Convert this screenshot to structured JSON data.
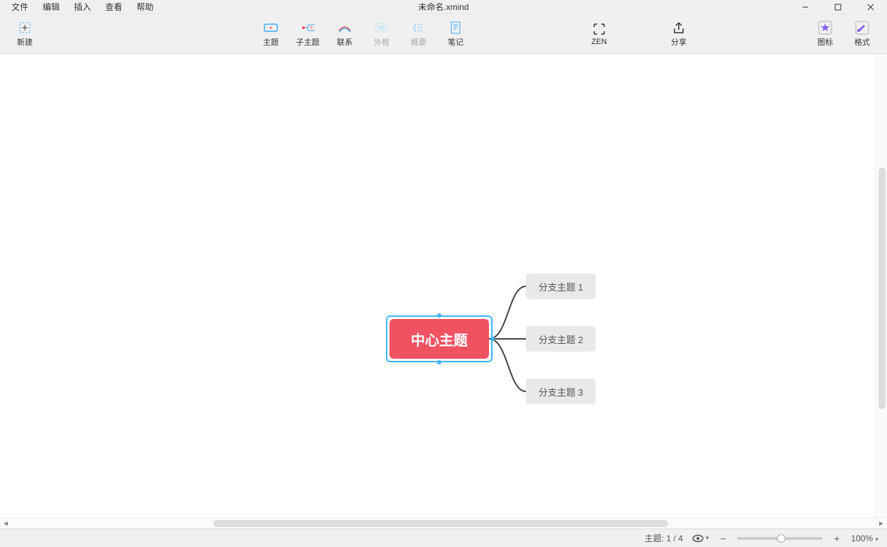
{
  "window": {
    "title": "未命名.xmind"
  },
  "menu": {
    "file": "文件",
    "edit": "编辑",
    "insert": "插入",
    "view": "查看",
    "help": "帮助"
  },
  "toolbar": {
    "new": "新建",
    "topic": "主题",
    "subtopic": "子主题",
    "relation": "联系",
    "boundary": "外框",
    "summary": "概要",
    "notes": "笔记",
    "zen": "ZEN",
    "share": "分享",
    "icons": "图标",
    "format": "格式"
  },
  "mindmap": {
    "central": "中心主题",
    "branches": [
      "分支主题 1",
      "分支主题 2",
      "分支主题 3"
    ]
  },
  "status": {
    "topic_label": "主题:",
    "topic_count": "1 / 4",
    "zoom": "100%"
  }
}
